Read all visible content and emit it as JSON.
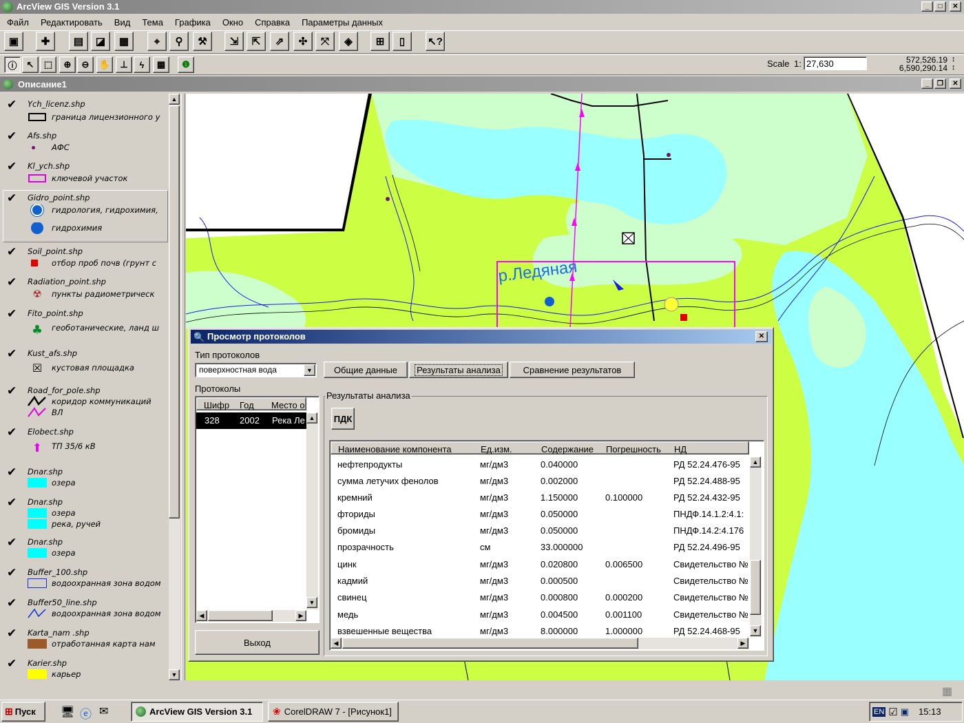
{
  "app": {
    "title": "ArcView GIS Version 3.1",
    "menu": [
      "Файл",
      "Редактировать",
      "Вид",
      "Тема",
      "Графика",
      "Окно",
      "Справка",
      "Параметры данных"
    ],
    "scale_label": "Scale",
    "scale_prefix": "1:",
    "scale_value": "27,630",
    "coord_x": "572,526.19",
    "coord_y": "6,590,290.14"
  },
  "view": {
    "title": "Описание1",
    "map_label": "р.Ледяная"
  },
  "legend": {
    "layers": [
      {
        "name": "Ych_licenz.shp",
        "items": [
          {
            "icon": "outline-rect-icon",
            "label": "граница лицензионного у"
          }
        ]
      },
      {
        "name": "Afs.shp",
        "items": [
          {
            "icon": "dot-icon",
            "label": "АФС"
          }
        ]
      },
      {
        "name": "Kl_ych.shp",
        "items": [
          {
            "icon": "magenta-rect-icon",
            "label": "ключевой участок"
          }
        ]
      },
      {
        "name": "Gidro_point.shp",
        "items": [
          {
            "icon": "water-drop-icon",
            "label": "гидрология, гидрохимия,"
          },
          {
            "icon": "hydrochem-icon",
            "label": "гидрохимия"
          }
        ]
      },
      {
        "name": "Soil_point.shp",
        "items": [
          {
            "icon": "red-square-icon",
            "label": "отбор проб почв (грунт с"
          }
        ]
      },
      {
        "name": "Radiation_point.shp",
        "items": [
          {
            "icon": "radiation-icon",
            "label": "пункты радиометрическ"
          }
        ]
      },
      {
        "name": "Fito_point.shp",
        "items": [
          {
            "icon": "tree-icon",
            "label": "геоботанические, ланд ш"
          }
        ]
      },
      {
        "name": "Kust_afs.shp",
        "items": [
          {
            "icon": "crossed-box-icon",
            "label": "кустовая площадка"
          }
        ]
      },
      {
        "name": "Road_for_pole.shp",
        "items": [
          {
            "icon": "corridor-line-icon",
            "label": "коридор коммуникаций"
          },
          {
            "icon": "vl-line-icon",
            "label": "ВЛ"
          }
        ]
      },
      {
        "name": "Elobect.shp",
        "items": [
          {
            "icon": "substation-arrow-icon",
            "label": "ТП 35/6 кВ"
          }
        ]
      },
      {
        "name": "Dnar.shp",
        "items": [
          {
            "icon": "cyan-fill-icon",
            "label": "озера"
          }
        ]
      },
      {
        "name": "Dnar.shp",
        "items": [
          {
            "icon": "cyan-fill-icon",
            "label": "озера"
          },
          {
            "icon": "cyan-fill-icon",
            "label": "река, ручей"
          }
        ]
      },
      {
        "name": "Dnar.shp",
        "items": [
          {
            "icon": "cyan-fill-icon",
            "label": "озера"
          }
        ]
      },
      {
        "name": "Buffer_100.shp",
        "items": [
          {
            "icon": "blue-outline-rect-icon",
            "label": "водоохранная зона водом"
          }
        ]
      },
      {
        "name": "Buffer50_line.shp",
        "items": [
          {
            "icon": "blue-zigzag-icon",
            "label": "водоохранная зона водом"
          }
        ]
      },
      {
        "name": "Karta_nam .shp",
        "items": [
          {
            "icon": "brown-fill-icon",
            "label": "отработанная карта нам"
          }
        ]
      },
      {
        "name": "Karier.shp",
        "items": [
          {
            "icon": "yellow-fill-icon",
            "label": "карьер"
          }
        ]
      }
    ]
  },
  "dialog": {
    "title": "Просмотр протоколов",
    "type_label": "Тип протоколов",
    "type_value": "поверхностная вода",
    "tabs": [
      "Общие данные",
      "Результаты анализа",
      "Сравнение результатов"
    ],
    "protocols_label": "Протоколы",
    "protocol_columns": [
      "Шифр",
      "Год",
      "Место о"
    ],
    "protocols": [
      {
        "code": "328",
        "year": "2002",
        "place": "Река Ле"
      }
    ],
    "exit_label": "Выход",
    "results_group_label": "Результаты анализа",
    "pdk_label": "ПДК",
    "result_columns": [
      "Наименование компонента",
      "Ед.изм.",
      "Содержание",
      "Погрешность",
      "НД"
    ],
    "results": [
      {
        "name": "нефтепродукты",
        "unit": "мг/дм3",
        "value": "0.040000",
        "error": "",
        "nd": "РД 52.24.476-95"
      },
      {
        "name": "сумма летучих фенолов",
        "unit": "мг/дм3",
        "value": "0.002000",
        "error": "",
        "nd": "РД 52.24.488-95"
      },
      {
        "name": "кремний",
        "unit": "мг/дм3",
        "value": "1.150000",
        "error": "0.100000",
        "nd": "РД 52.24.432-95"
      },
      {
        "name": "фториды",
        "unit": "мг/дм3",
        "value": "0.050000",
        "error": "",
        "nd": "ПНДФ.14.1.2:4.1:"
      },
      {
        "name": "бромиды",
        "unit": "мг/дм3",
        "value": "0.050000",
        "error": "",
        "nd": "ПНДФ.14.2:4.176"
      },
      {
        "name": "прозрачность",
        "unit": "см",
        "value": "33.000000",
        "error": "",
        "nd": "РД 52.24.496-95"
      },
      {
        "name": "цинк",
        "unit": "мг/дм3",
        "value": "0.020800",
        "error": "0.006500",
        "nd": "Свидетельство №"
      },
      {
        "name": "кадмий",
        "unit": "мг/дм3",
        "value": "0.000500",
        "error": "",
        "nd": "Свидетельство №"
      },
      {
        "name": "свинец",
        "unit": "мг/дм3",
        "value": "0.000800",
        "error": "0.000200",
        "nd": "Свидетельство №"
      },
      {
        "name": "медь",
        "unit": "мг/дм3",
        "value": "0.004500",
        "error": "0.001100",
        "nd": "Свидетельство №"
      },
      {
        "name": "взвешенные вещества",
        "unit": "мг/дм3",
        "value": "8.000000",
        "error": "1.000000",
        "nd": "РД 52.24.468-95"
      }
    ]
  },
  "taskbar": {
    "start_label": "Пуск",
    "tasks": [
      "ArcView GIS Version 3.1",
      "CorelDRAW 7 - [Рисунок1]"
    ],
    "lang": "EN",
    "time": "15:13"
  }
}
